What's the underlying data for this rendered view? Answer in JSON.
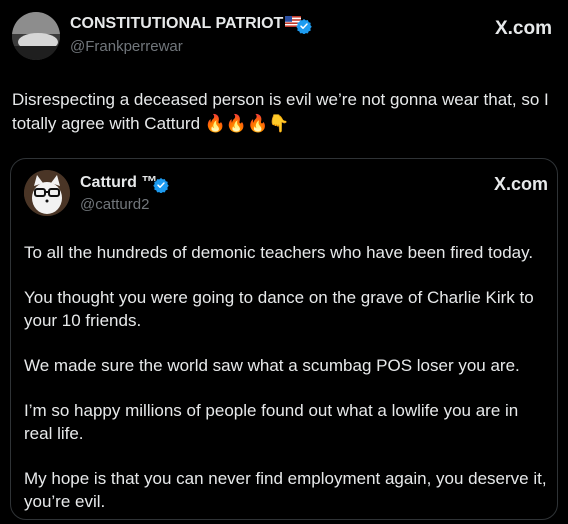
{
  "outer": {
    "name": "CONSTITUTIONAL PATRIOT",
    "handle": "@Frankperrewar",
    "site": "X.com",
    "text": "Disrespecting a deceased person is evil we’re not gonna wear that, so I totally agree with Catturd 🔥🔥🔥👇"
  },
  "quote": {
    "name": "Catturd ™",
    "handle": "@catturd2",
    "site": "X.com",
    "paragraphs": [
      "To all the hundreds of demonic teachers who have been fired today.",
      "You thought you were going to dance on the grave of Charlie Kirk to your 10 friends.",
      "We made sure the world saw what a scumbag POS loser you are.",
      "I’m so happy millions of people found out what a lowlife you are in real life.",
      "My hope is that you can never find employment again, you deserve it, you’re evil."
    ]
  },
  "colors": {
    "background": "#000000",
    "text": "#e7e9ea",
    "secondary": "#71767b",
    "verified": "#1d9bf0"
  }
}
